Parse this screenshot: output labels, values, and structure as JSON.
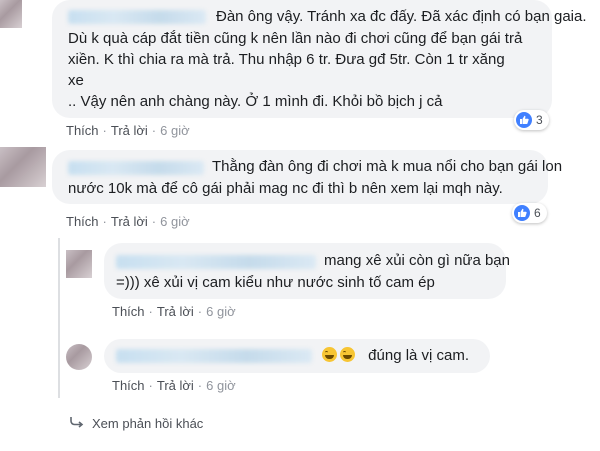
{
  "comments": [
    {
      "lines": [
        "Đàn ông vậy. Tránh xa đc đấy. Đã xác định có bạn gaia.",
        "Dù k quà cáp đắt tiền cũng k nên lần nào đi chơi cũng để bạn gái trả",
        "xiền. K thì chia ra mà trả. Thu nhập 6 tr. Đưa gđ 5tr. Còn 1 tr xăng",
        "xe",
        ".. Vậy nên anh chàng này. Ở 1 mình đi. Khỏi bồ bịch j cả"
      ],
      "actions": {
        "like": "Thích",
        "reply": "Trả lời",
        "time": "6 giờ"
      },
      "reactions": "3"
    },
    {
      "lines": [
        "Thằng đàn ông đi chơi mà k mua nổi cho bạn gái lon",
        "nước 10k mà để cô gái phải mag nc đi thì b nên xem lại mqh này."
      ],
      "actions": {
        "like": "Thích",
        "reply": "Trả lời",
        "time": "6 giờ"
      },
      "reactions": "6"
    }
  ],
  "replies": [
    {
      "lines": [
        "mang xê xủi còn gì nữa bạn",
        "=))) xê xủi vị cam kiểu như nước sinh tố cam ép"
      ],
      "actions": {
        "like": "Thích",
        "reply": "Trả lời",
        "time": "6 giờ"
      }
    },
    {
      "text": "đúng là vị cam.",
      "actions": {
        "like": "Thích",
        "reply": "Trả lời",
        "time": "6 giờ"
      }
    }
  ],
  "more_replies": "Xem phản hồi khác",
  "colors": {
    "bubble": "#f2f3f5",
    "link": "#4b4f56",
    "like_blue": "#4080ff"
  },
  "icons": {
    "like": "thumbs-up-icon",
    "emoji": "laughing-emoji-icon",
    "reply_arrow": "reply-arrow-icon"
  }
}
